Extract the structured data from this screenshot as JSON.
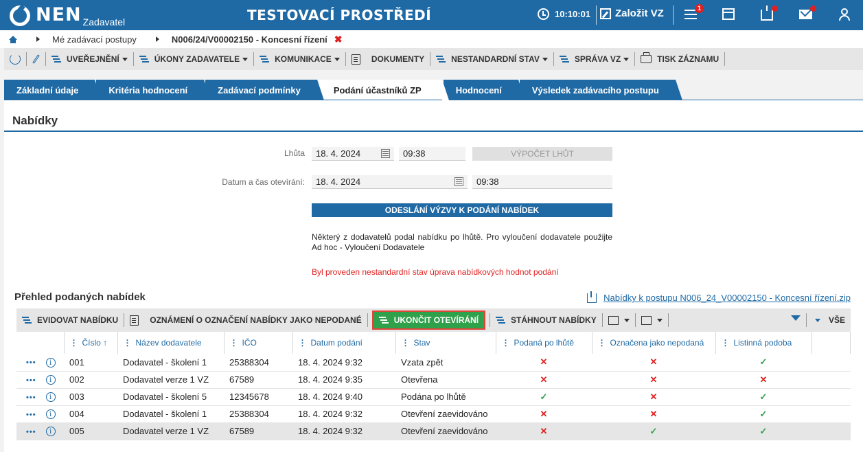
{
  "header": {
    "logo": "NEN",
    "logo_sub": "Zadavatel",
    "title": "TESTOVACÍ PROSTŘEDÍ",
    "clock": "10:10:01",
    "create_label": "Založit VZ",
    "menu_badge": "1"
  },
  "breadcrumb": {
    "items": [
      "Mé zadávací postupy",
      "N006/24/V00002150 - Koncesní řízení"
    ]
  },
  "toolbar": {
    "items": [
      "UVEŘEJNĚNÍ",
      "ÚKONY ZADAVATELE",
      "KOMUNIKACE",
      "DOKUMENTY",
      "NESTANDARDNÍ STAV",
      "SPRÁVA VZ",
      "TISK ZÁZNAMU"
    ]
  },
  "tabs": [
    "Základní údaje",
    "Kritéria hodnocení",
    "Zadávací podmínky",
    "Podání účastníků ZP",
    "Hodnocení",
    "Výsledek zadávacího postupu"
  ],
  "active_tab": "Podání účastníků ZP",
  "section": {
    "title": "Nabídky",
    "deadline_label": "Lhůta",
    "deadline_date": "18. 4. 2024",
    "deadline_time": "09:38",
    "calc_button": "VÝPOČET LHŮT",
    "opening_label": "Datum a čas otevírání:",
    "opening_date": "18. 4. 2024",
    "opening_time": "09:38",
    "send_button": "ODESLÁNÍ VÝZVY K PODÁNÍ NABÍDEK",
    "notice": "Některý z dodavatelů podal nabídku po lhůtě. Pro vyloučení dodavatele použijte Ad hoc - Vyloučení Dodavatele",
    "notice_red": "Byl proveden nestandardní stav úprava nabídkových hodnot podání"
  },
  "overview": {
    "title": "Přehled podaných nabídek",
    "zip_link": "Nabídky k postupu N006_24_V00002150 - Koncesní řízení.zip",
    "toolbar": {
      "record": "EVIDOVAT NABÍDKU",
      "notify": "OZNÁMENÍ O OZNAČENÍ NABÍDKY JAKO NEPODANÉ",
      "finish": "UKONČIT OTEVÍRÁNÍ",
      "download": "STÁHNOUT NABÍDKY",
      "all": "VŠE"
    },
    "columns": [
      "Číslo",
      "Název dodavatele",
      "IČO",
      "Datum podání",
      "Stav",
      "Podaná po lhůtě",
      "Označena jako nepodaná",
      "Listinná podoba"
    ],
    "sort_arrow": "↑",
    "rows": [
      {
        "cislo": "001",
        "nazev": "Dodavatel - školení 1",
        "ico": "25388304",
        "datum": "18. 4. 2024 9:32",
        "stav": "Vzata zpět",
        "po_lhute": "✕",
        "nepodana": "✕",
        "listinna": "✓"
      },
      {
        "cislo": "002",
        "nazev": "Dodavatel verze 1 VZ",
        "ico": "67589",
        "datum": "18. 4. 2024 9:35",
        "stav": "Otevřena",
        "po_lhute": "✕",
        "nepodana": "✕",
        "listinna": "✕"
      },
      {
        "cislo": "003",
        "nazev": "Dodavatel - školení 5",
        "ico": "12345678",
        "datum": "18. 4. 2024 9:40",
        "stav": "Podána po lhůtě",
        "po_lhute": "✓",
        "nepodana": "✕",
        "listinna": "✓"
      },
      {
        "cislo": "004",
        "nazev": "Dodavatel - školení 1",
        "ico": "25388304",
        "datum": "18. 4. 2024 9:32",
        "stav": "Otevření zaevidováno",
        "po_lhute": "✕",
        "nepodana": "✕",
        "listinna": "✓"
      },
      {
        "cislo": "005",
        "nazev": "Dodavatel verze 1 VZ",
        "ico": "67589",
        "datum": "18. 4. 2024 9:32",
        "stav": "Otevření zaevidováno",
        "po_lhute": "✕",
        "nepodana": "✓",
        "listinna": "✓"
      }
    ]
  }
}
